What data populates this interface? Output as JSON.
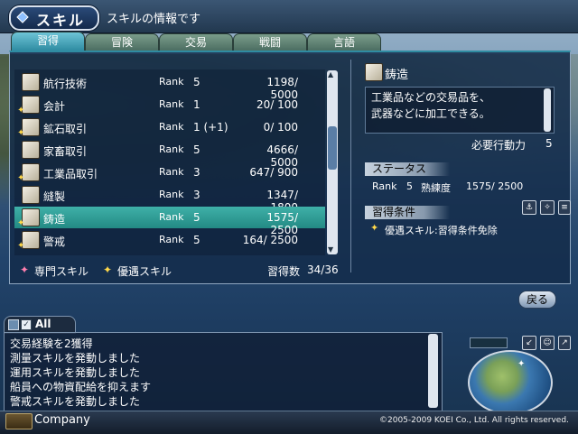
{
  "header": {
    "title": "スキル",
    "subtitle": "スキルの情報です"
  },
  "tabs": [
    {
      "label": "習得",
      "active": true
    },
    {
      "label": "冒険",
      "active": false
    },
    {
      "label": "交易",
      "active": false
    },
    {
      "label": "戦闘",
      "active": false
    },
    {
      "label": "言語",
      "active": false
    }
  ],
  "skills": [
    {
      "name": "航行技術",
      "rank_label": "Rank",
      "rank": "5",
      "exp": "1198/ 5000",
      "star": false,
      "selected": false
    },
    {
      "name": "会計",
      "rank_label": "Rank",
      "rank": "1",
      "exp": "20/  100",
      "star": true,
      "selected": false
    },
    {
      "name": "鉱石取引",
      "rank_label": "Rank",
      "rank": "1 (+1)",
      "exp": "0/  100",
      "star": true,
      "selected": false
    },
    {
      "name": "家畜取引",
      "rank_label": "Rank",
      "rank": "5",
      "exp": "4666/ 5000",
      "star": false,
      "selected": false
    },
    {
      "name": "工業品取引",
      "rank_label": "Rank",
      "rank": "3",
      "exp": "647/  900",
      "star": true,
      "selected": false
    },
    {
      "name": "縫製",
      "rank_label": "Rank",
      "rank": "3",
      "exp": "1347/ 1800",
      "star": false,
      "selected": false
    },
    {
      "name": "鋳造",
      "rank_label": "Rank",
      "rank": "5",
      "exp": "1575/ 2500",
      "star": true,
      "selected": true
    },
    {
      "name": "警戒",
      "rank_label": "Rank",
      "rank": "5",
      "exp": "164/ 2500",
      "star": true,
      "selected": false
    }
  ],
  "legend": {
    "specialty": "専門スキル",
    "preferred": "優遇スキル",
    "learned_label": "習得数",
    "learned_count": "34/36"
  },
  "detail": {
    "title": "鋳造",
    "description_line1": "工業品などの交易品を、",
    "description_line2": "武器などに加工できる。",
    "action_label": "必要行動力",
    "action_value": "5",
    "status_header": "ステータス",
    "status_rank_label": "Rank",
    "status_rank": "5",
    "status_prof_label": "熟練度",
    "status_prof": "1575/ 2500",
    "conditions_header": "習得条件",
    "condition_text": "優遇スキル:習得条件免除"
  },
  "back_button": "戻る",
  "chat": {
    "channel": "All",
    "lines": [
      "交易経験を2獲得",
      "測量スキルを発動しました",
      "運用スキルを発動しました",
      "船員への物資配給を抑えます",
      "警戒スキルを発動しました"
    ]
  },
  "footer": {
    "company": "Company",
    "copyright": "©2005-2009 KOEI Co., Ltd.  All rights reserved."
  },
  "colors": {
    "selected_row": "#3fb0a8",
    "star": "#ffd84a",
    "specialty_star": "#ff7fae",
    "panel": "#142c4a"
  }
}
